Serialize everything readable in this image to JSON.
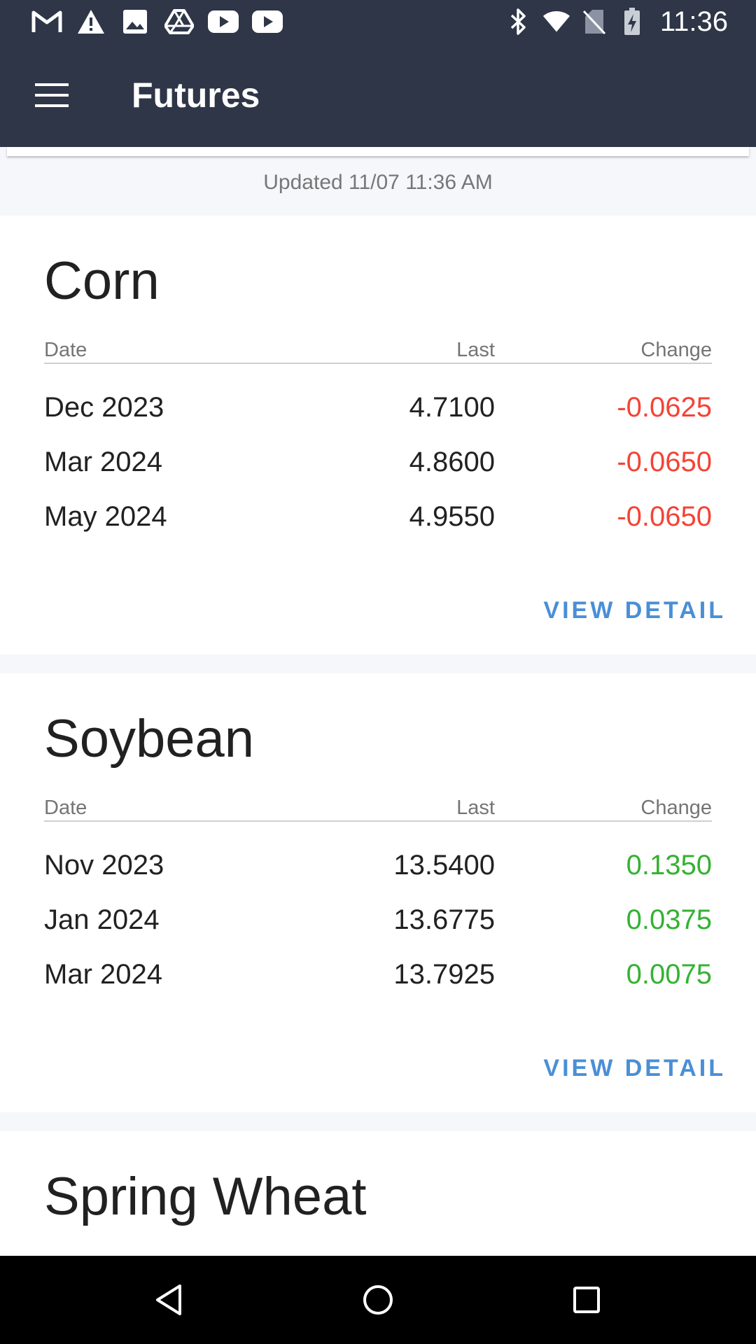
{
  "status_bar": {
    "time": "11:36",
    "left_icons": [
      "gmail-icon",
      "alert-icon",
      "image-icon",
      "drive-icon",
      "youtube-icon",
      "youtube-icon"
    ],
    "right_icons": [
      "bluetooth-icon",
      "wifi-icon",
      "no-sim-icon",
      "battery-charging-icon"
    ]
  },
  "app_bar": {
    "title": "Futures",
    "menu_icon": "hamburger-menu-icon"
  },
  "updated_text": "Updated 11/07 11:36 AM",
  "columns": {
    "date": "Date",
    "last": "Last",
    "change": "Change"
  },
  "cards": [
    {
      "title": "Corn",
      "rows": [
        {
          "date": "Dec 2023",
          "last": "4.7100",
          "change": "-0.0625"
        },
        {
          "date": "Mar 2024",
          "last": "4.8600",
          "change": "-0.0650"
        },
        {
          "date": "May 2024",
          "last": "4.9550",
          "change": "-0.0650"
        }
      ],
      "action": "VIEW DETAIL"
    },
    {
      "title": "Soybean",
      "rows": [
        {
          "date": "Nov 2023",
          "last": "13.5400",
          "change": "0.1350"
        },
        {
          "date": "Jan 2024",
          "last": "13.6775",
          "change": "0.0375"
        },
        {
          "date": "Mar 2024",
          "last": "13.7925",
          "change": "0.0075"
        }
      ],
      "action": "VIEW DETAIL"
    },
    {
      "title": "Spring Wheat"
    }
  ],
  "colors": {
    "app_bar": "#2e3648",
    "negative": "#f44336",
    "positive": "#34b233",
    "action": "#4a8fd6"
  },
  "nav_bar": [
    "back-icon",
    "home-icon",
    "recents-icon"
  ]
}
